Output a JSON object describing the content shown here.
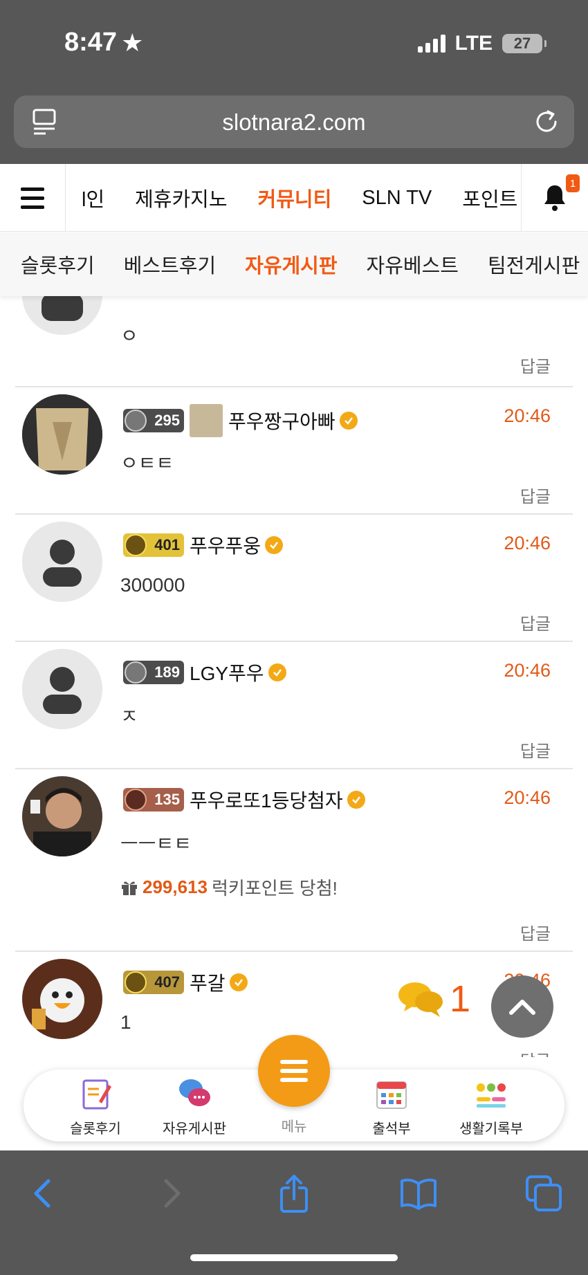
{
  "status_bar": {
    "time": "8:47",
    "network": "LTE",
    "battery": "27"
  },
  "browser": {
    "url": "slotnara2.com"
  },
  "main_nav": {
    "items": [
      {
        "label": "l인",
        "active": false
      },
      {
        "label": "제휴카지노",
        "active": false
      },
      {
        "label": "커뮤니티",
        "active": true
      },
      {
        "label": "SLN TV",
        "active": false
      },
      {
        "label": "포인트",
        "active": false
      }
    ],
    "notification_count": "1"
  },
  "sub_nav": {
    "items": [
      {
        "label": "슬롯후기",
        "active": false
      },
      {
        "label": "베스트후기",
        "active": false
      },
      {
        "label": "자유게시판",
        "active": true
      },
      {
        "label": "자유베스트",
        "active": false
      },
      {
        "label": "팀전게시판",
        "active": false
      }
    ]
  },
  "comments": [
    {
      "nickname": "",
      "level": "",
      "time": "",
      "text": "ㅇ",
      "reply": "답글"
    },
    {
      "nickname": "푸우짱구아빠",
      "level": "295",
      "time": "20:46",
      "text": "ㅇㅌㅌ",
      "reply": "답글"
    },
    {
      "nickname": "푸우푸웅",
      "level": "401",
      "time": "20:46",
      "text": "300000",
      "reply": "답글"
    },
    {
      "nickname": "LGY푸우",
      "level": "189",
      "time": "20:46",
      "text": "ㅈ",
      "reply": "답글"
    },
    {
      "nickname": "푸우로또1등당첨자",
      "level": "135",
      "time": "20:46",
      "text": "ㅡㅡㅌㅌ",
      "lucky_points": "299,613",
      "lucky_text": "럭키포인트 당첨!",
      "reply": "답글"
    },
    {
      "nickname": "푸갈",
      "level": "407",
      "time": "20:46",
      "text": "1",
      "reply": "답글"
    }
  ],
  "floating": {
    "chat_count": "1"
  },
  "bottom_bar": {
    "items": [
      {
        "label": "슬롯후기",
        "icon": "notepad-icon"
      },
      {
        "label": "자유게시판",
        "icon": "chat-bubbles-icon"
      },
      {
        "label": "메뉴",
        "icon": "menu-icon"
      },
      {
        "label": "출석부",
        "icon": "calendar-icon"
      },
      {
        "label": "생활기록부",
        "icon": "emoji-record-icon"
      }
    ]
  },
  "colors": {
    "accent": "#f15a14",
    "fab": "#f39b16",
    "ios_chrome": "#575757"
  }
}
